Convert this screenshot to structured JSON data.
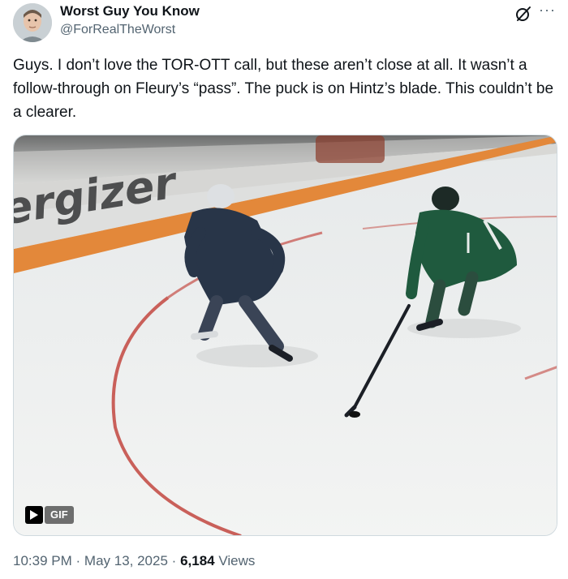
{
  "author": {
    "name": "Worst Guy You Know",
    "handle": "@ForRealTheWorst"
  },
  "tweet": {
    "text": "Guys. I don’t love the TOR-OTT call, but these aren’t close at all. It wasn’t a follow-through on Fleury’s “pass”. The puck is on Hintz’s blade. This couldn’t be a clearer."
  },
  "media": {
    "type": "gif",
    "badge_label": "GIF",
    "board_ad_text": "ergizer"
  },
  "meta": {
    "time": "10:39 PM",
    "separator": "·",
    "date": "May 13, 2025",
    "views_count": "6,184",
    "views_label": "Views"
  },
  "icons": {
    "grok": "grok-icon",
    "more": "more-options-icon",
    "play": "play-icon"
  },
  "colors": {
    "text_primary": "#0f1419",
    "text_secondary": "#536471",
    "board_orange": "#e5863b",
    "red_line": "#c9605a",
    "green_jersey": "#1f5a3e",
    "navy_jersey": "#283548"
  }
}
